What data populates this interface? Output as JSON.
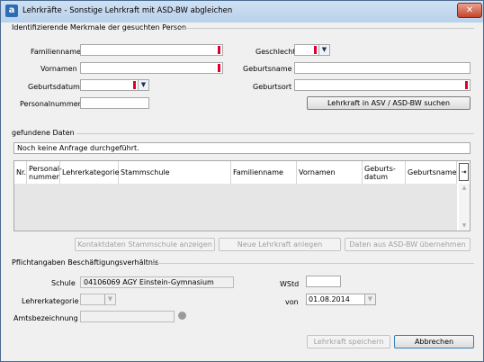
{
  "window": {
    "title": "Lehrkräfte - Sonstige Lehrkraft mit ASD-BW abgleichen",
    "close_glyph": "✕",
    "app_icon_glyph": "a"
  },
  "search": {
    "section_title": "Identifizierende Merkmale der gesuchten Person",
    "familienname_label": "Familienname",
    "vornamen_label": "Vornamen",
    "geburtsdatum_label": "Geburtsdatum",
    "personalnummer_label": "Personalnummer",
    "geschlecht_label": "Geschlecht",
    "geburtsname_label": "Geburtsname",
    "geburtsort_label": "Geburtsort",
    "familienname_value": "",
    "vornamen_value": "",
    "geburtsdatum_value": "",
    "personalnummer_value": "",
    "geschlecht_value": "",
    "geburtsname_value": "",
    "geburtsort_value": "",
    "search_button": "Lehrkraft in ASV / ASD-BW suchen"
  },
  "results": {
    "section_title": "gefundene Daten",
    "status_text": "Noch keine Anfrage durchgeführt.",
    "columns": [
      "Nr.",
      "Personal-\nnummer",
      "Lehrerkategorie",
      "Stammschule",
      "Familienname",
      "Vornamen",
      "Geburts-\ndatum",
      "Geburtsname"
    ],
    "rows": [],
    "column_chooser_glyph": "⇥",
    "buttons": {
      "contact": "Kontaktdaten Stammschule anzeigen",
      "new": "Neue Lehrkraft anlegen",
      "apply": "Daten aus ASD-BW übernehmen"
    }
  },
  "employment": {
    "section_title": "Pflichtangaben Beschäftigungsverhältnis",
    "schule_label": "Schule",
    "schule_value": "04106069 AGY Einstein-Gymnasium",
    "lehrerkategorie_label": "Lehrerkategorie",
    "lehrerkategorie_value": "",
    "amtsbezeichnung_label": "Amtsbezeichnung",
    "amtsbezeichnung_value": "",
    "wstd_label": "WStd",
    "wstd_value": "",
    "von_label": "von",
    "von_value": "01.08.2014"
  },
  "footer": {
    "save_button": "Lehrkraft speichern",
    "cancel_button": "Abbrechen"
  },
  "icons": {
    "dropdown_glyph": "▼",
    "scroll_up_glyph": "▲",
    "scroll_down_glyph": "▼"
  },
  "colors": {
    "required_marker": "#e0002b",
    "title_bar": "#c3d8ef",
    "close_button": "#c4452b"
  }
}
